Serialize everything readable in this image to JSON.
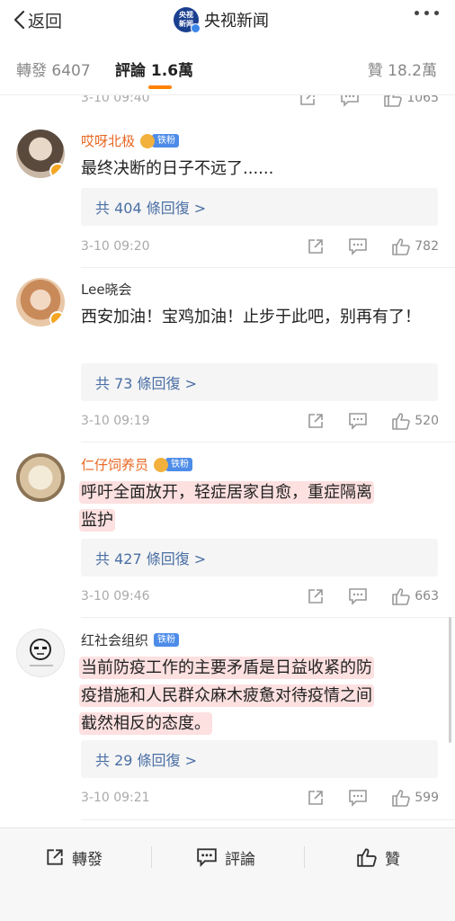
{
  "nav": {
    "back_label": "返回",
    "title": "央视新闻",
    "logo_line1": "央视",
    "logo_line2": "新闻"
  },
  "tabs": {
    "repost": "轉發 6407",
    "comment": "評論 1.6萬",
    "like": "贊 18.2萬"
  },
  "prev_item": {
    "time": "3-10 09:40",
    "likes": "1065"
  },
  "comments": [
    {
      "user": "哎呀北极",
      "badge": "铁粉",
      "text": "最终决断的日子不远了......",
      "replies": "共 404 條回復 >",
      "time": "3-10 09:20",
      "likes": "782"
    },
    {
      "user": "Lee晓会",
      "text": "西安加油！宝鸡加油！止步于此吧，别再有了！",
      "replies": "共 73 條回復 >",
      "time": "3-10 09:19",
      "likes": "520"
    },
    {
      "user": "仁仔饲养员",
      "badge": "铁粉",
      "text_line1": "呼吁全面放开，轻症居家自愈，重症隔离",
      "text_line2": "监护",
      "replies": "共 427 條回復 >",
      "time": "3-10 09:46",
      "likes": "663"
    },
    {
      "user": "红社会组织",
      "badge": "铁粉",
      "text_line1": "当前防疫工作的主要矛盾是日益收紧的防",
      "text_line2": "疫措施和人民群众麻木疲惫对待疫情之间",
      "text_line3": "截然相反的态度。",
      "replies": "共 29 條回復 >",
      "time": "3-10 09:21",
      "likes": "599"
    }
  ],
  "bottom": {
    "repost": "轉發",
    "comment": "評論",
    "like": "贊"
  },
  "colors": {
    "accent": "#ff8200",
    "username_orange": "#e86722",
    "link_blue": "#4a6fa5",
    "highlight": "#fde0e0"
  }
}
